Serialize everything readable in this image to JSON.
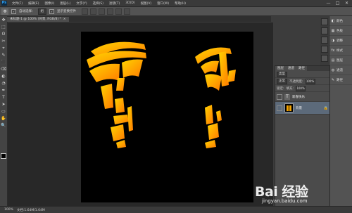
{
  "menubar": {
    "logo": "Ps",
    "items": [
      "文件(F)",
      "编辑(E)",
      "图像(I)",
      "图层(L)",
      "文字(Y)",
      "选择(S)",
      "滤镜(T)",
      "3D(D)",
      "视图(V)",
      "窗口(W)",
      "帮助(H)"
    ],
    "minimize": "—",
    "maximize": "□",
    "close": "✕"
  },
  "options": {
    "tool_glyph": "✥",
    "auto_select_label": "自动选择：",
    "auto_select_value": "组",
    "show_transform_label": "显示变换控件"
  },
  "document": {
    "tab_title": "未标题-1 @ 100% (背景, RGB/8) *",
    "close": "×"
  },
  "tools": [
    "✥",
    "⬚",
    "ʘ",
    "✂",
    "⌖",
    "✎",
    "⬛",
    "⌫",
    "◐",
    "◔",
    "✒",
    "T",
    "➤",
    "▭",
    "✋",
    "🔍"
  ],
  "status": {
    "zoom": "100%",
    "doc_info": "文档:1.64M/1.64M"
  },
  "right_panel": {
    "items": [
      {
        "icon": "◧",
        "label": "颜色"
      },
      {
        "icon": "▦",
        "label": "色板"
      },
      {
        "icon": "◑",
        "label": "调整"
      },
      {
        "icon": "fx",
        "label": "样式"
      },
      {
        "icon": "▤",
        "label": "图层"
      },
      {
        "icon": "◍",
        "label": "通道"
      },
      {
        "icon": "✎",
        "label": "路径"
      }
    ]
  },
  "layers_panel": {
    "tabs": [
      "图层",
      "通道",
      "路径"
    ],
    "filter_value": "类型",
    "blend_mode": "正常",
    "opacity_label": "不透明度:",
    "opacity_value": "100%",
    "lock_label": "锁定:",
    "fill_label": "填充:",
    "fill_value": "100%",
    "layers": [
      {
        "name": "新春快乐",
        "kind": "text",
        "glyph": "T"
      },
      {
        "name": "背景",
        "kind": "image",
        "lock": "🔒"
      }
    ]
  },
  "watermark": {
    "brand": "Bai 经验",
    "url": "jingyan.baidu.com"
  },
  "colors": {
    "canvas": "#000000",
    "text_gradient_start": "#ffd400",
    "text_gradient_end": "#ff7a00"
  }
}
